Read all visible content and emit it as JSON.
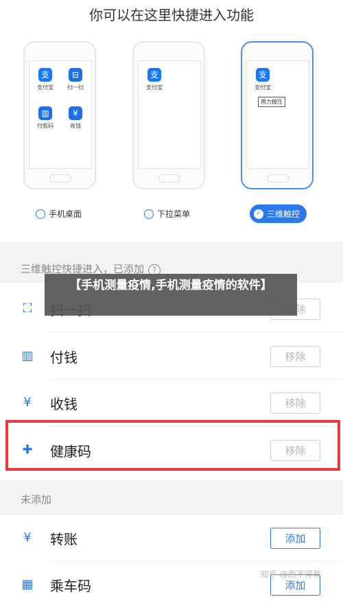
{
  "heading": "你可以在这里快捷进入功能",
  "phones": [
    {
      "apps": [
        {
          "icon": "支",
          "label": "支付宝"
        },
        {
          "icon": "⊟",
          "label": "扫一扫"
        },
        {
          "icon": "▥",
          "label": "付款码"
        },
        {
          "icon": "¥",
          "label": "收钱"
        }
      ]
    },
    {
      "apps": [
        {
          "icon": "支",
          "label": "支付宝"
        }
      ]
    },
    {
      "apps": [
        {
          "icon": "支",
          "label": "支付宝"
        }
      ],
      "press_label": "用力按压"
    }
  ],
  "modes": [
    {
      "label": "手机桌面",
      "selected": false
    },
    {
      "label": "下拉菜单",
      "selected": false
    },
    {
      "label": "三维触控",
      "selected": true
    }
  ],
  "added_section": {
    "title": "三维触控快捷进入，已添加",
    "help": "?"
  },
  "overlay_text": "【手机测量疫情,手机测量疫情的软件】",
  "added_items": [
    {
      "icon": "⛶",
      "label": "扫一扫",
      "button": "移除"
    },
    {
      "icon": "▥",
      "label": "付钱",
      "button": "移除"
    },
    {
      "icon": "¥",
      "label": "收钱",
      "button": "移除"
    },
    {
      "icon": "✚",
      "label": "健康码",
      "button": "移除"
    }
  ],
  "not_added_section": {
    "title": "未添加"
  },
  "not_added_items": [
    {
      "icon": "¥",
      "label": "转账",
      "button": "添加"
    },
    {
      "icon": "▦",
      "label": "乘车码",
      "button": "添加"
    }
  ],
  "watermark": "知乎 @西不得蒂",
  "colors": {
    "accent": "#2d78e8",
    "highlight": "#e8393c",
    "band": "#f3f3f3"
  }
}
